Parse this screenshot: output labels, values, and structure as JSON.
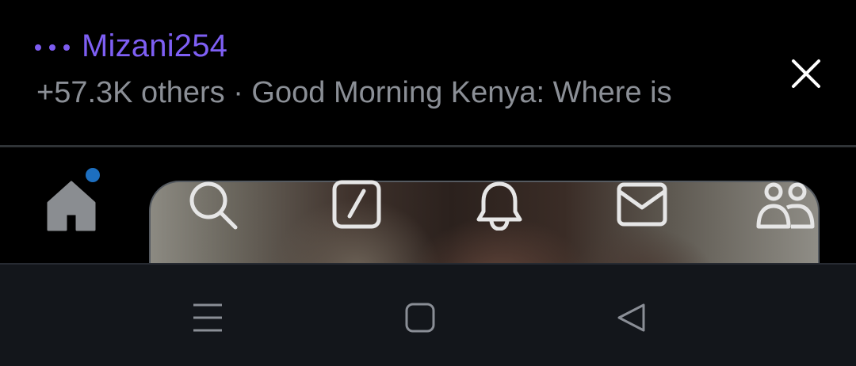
{
  "space_banner": {
    "host_name": "Mizani254",
    "listeners_text": "+57.3K others · Good Morning Kenya: Where is",
    "icons": {
      "more": "more-dots-icon",
      "close": "close-icon"
    },
    "accent_color": "#7e5ff4"
  },
  "tab_bar": {
    "tabs": [
      {
        "name": "home",
        "icon": "home-icon",
        "active": true,
        "has_badge": true
      },
      {
        "name": "search",
        "icon": "search-icon"
      },
      {
        "name": "grok",
        "icon": "grok-icon"
      },
      {
        "name": "notifications",
        "icon": "bell-icon"
      },
      {
        "name": "messages",
        "icon": "mail-icon"
      },
      {
        "name": "communities",
        "icon": "people-icon"
      }
    ],
    "badge_color": "#1d6fc0"
  },
  "system_nav": {
    "buttons": [
      {
        "name": "recents",
        "icon": "menu-lines-icon"
      },
      {
        "name": "home",
        "icon": "square-icon"
      },
      {
        "name": "back",
        "icon": "back-triangle-icon"
      }
    ]
  }
}
